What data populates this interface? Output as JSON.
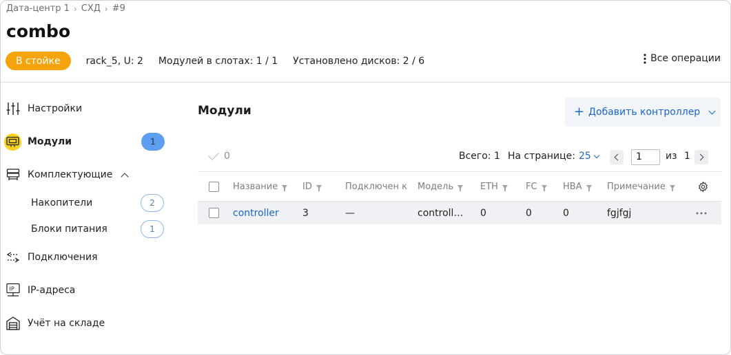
{
  "breadcrumb": [
    "Дата-центр 1",
    "СХД",
    "#9"
  ],
  "title": "combo",
  "status": "В стойке",
  "info": {
    "rack": "rack_5, U: 2",
    "modules": "Модулей в слотах: 1 / 1",
    "disks": "Установлено дисков: 2 / 6"
  },
  "all_ops": "Все операции",
  "sidebar": {
    "items": [
      {
        "label": "Настройки",
        "icon": "sliders-icon"
      },
      {
        "label": "Модули",
        "icon": "module-icon",
        "count": "1"
      },
      {
        "label": "Комплектующие",
        "icon": "server-icon"
      },
      {
        "label": "Подключения",
        "icon": "connections-icon"
      },
      {
        "label": "IP-адреса",
        "icon": "ip-icon"
      },
      {
        "label": "Учёт на складе",
        "icon": "warehouse-icon"
      }
    ],
    "sub_items": [
      {
        "label": "Накопители",
        "count": "2"
      },
      {
        "label": "Блоки питания",
        "count": "1"
      }
    ]
  },
  "main": {
    "title": "Модули",
    "add_button": "Добавить контроллер",
    "selected_count": "0",
    "total": "Всего: 1",
    "per_page_label": "На странице:",
    "per_page_value": "25",
    "page": "1",
    "of_label": "из",
    "of_total": "1"
  },
  "table": {
    "columns": [
      "Название",
      "ID",
      "Подключен к",
      "Модель",
      "ETH",
      "FC",
      "HBA",
      "Примечание"
    ],
    "rows": [
      {
        "name": "controller",
        "id": "3",
        "connected": "—",
        "model": "controll…",
        "eth": "0",
        "fc": "0",
        "hba": "0",
        "note": "fgjfgj"
      }
    ]
  },
  "colors": {
    "accent": "#1b66c9",
    "status": "#f5a50b",
    "active_icon": "#f7d21e",
    "badge": "#5f9ff2"
  }
}
